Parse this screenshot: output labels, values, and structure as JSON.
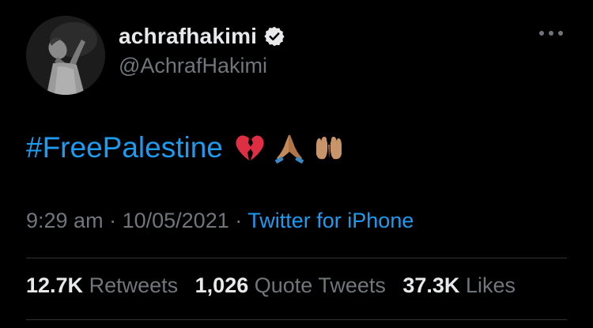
{
  "user": {
    "display_name": "achrafhakimi",
    "handle": "@AchrafHakimi",
    "verified_icon": "verified-badge-icon",
    "avatar_icon": "profile-photo"
  },
  "tweet": {
    "hashtag": "#FreePalestine",
    "emojis": [
      "broken-heart-emoji",
      "folded-hands-emoji",
      "palms-up-together-emoji"
    ]
  },
  "meta": {
    "time": "9:29 am",
    "separator": "·",
    "date": "10/05/2021",
    "source": "Twitter for iPhone"
  },
  "stats": {
    "retweets_count": "12.7K",
    "retweets_label": "Retweets",
    "quotes_count": "1,026",
    "quotes_label": "Quote Tweets",
    "likes_count": "37.3K",
    "likes_label": "Likes"
  },
  "colors": {
    "background": "#000000",
    "text": "#e7e9ea",
    "secondary": "#71767b",
    "link": "#1d9bf0",
    "divider": "#2f3336"
  },
  "icons": {
    "more": "more-options-icon"
  }
}
